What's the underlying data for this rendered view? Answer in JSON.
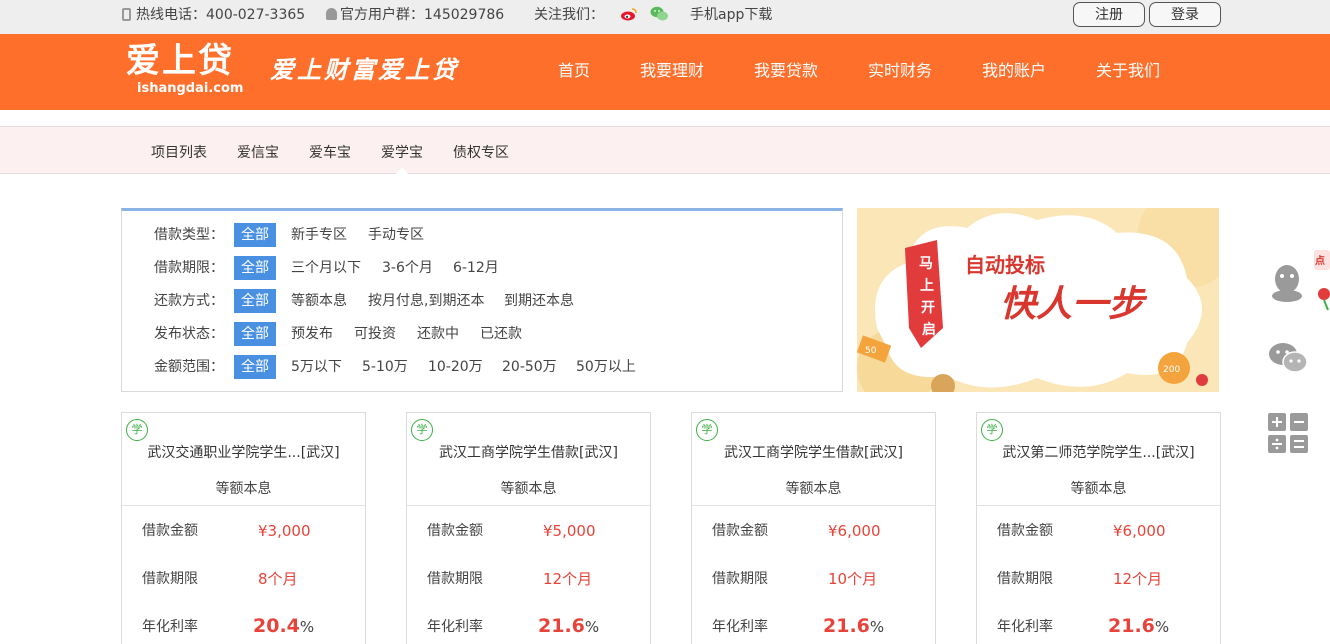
{
  "topbar": {
    "hotline": "热线电话：400-027-3365",
    "group": "官方用户群：145029786",
    "follow_label": "关注我们：",
    "app_download": "手机app下载",
    "register": "注册",
    "login": "登录",
    "social_icons": [
      "weibo-icon",
      "wechat-icon"
    ]
  },
  "header": {
    "logo_text": "爱上贷",
    "logo_domain": "ishangdai.com",
    "slogan": "爱上财富爱上贷",
    "nav": [
      "首页",
      "我要理财",
      "我要贷款",
      "实时财务",
      "我的账户",
      "关于我们"
    ]
  },
  "subnav": {
    "items": [
      "项目列表",
      "爱信宝",
      "爱车宝",
      "爱学宝",
      "债权专区"
    ],
    "active": "爱学宝"
  },
  "filters": [
    {
      "label": "借款类型：",
      "options": [
        "全部",
        "新手专区",
        "手动专区"
      ],
      "selected": "全部"
    },
    {
      "label": "借款期限：",
      "options": [
        "全部",
        "三个月以下",
        "3-6个月",
        "6-12月"
      ],
      "selected": "全部"
    },
    {
      "label": "还款方式：",
      "options": [
        "全部",
        "等额本息",
        "按月付息,到期还本",
        "到期还本息"
      ],
      "selected": "全部"
    },
    {
      "label": "发布状态：",
      "options": [
        "全部",
        "预发布",
        "可投资",
        "还款中",
        "已还款"
      ],
      "selected": "全部"
    },
    {
      "label": "金额范围：",
      "options": [
        "全部",
        "5万以下",
        "5-10万",
        "10-20万",
        "20-50万",
        "50万以上"
      ],
      "selected": "全部"
    }
  ],
  "banner": {
    "ribbon": [
      "马",
      "上",
      "开",
      "启"
    ],
    "line1": "自动投标",
    "line2": "快人一步",
    "coin_left": "50",
    "coin_right": "200"
  },
  "cards": [
    {
      "badge": "学",
      "title": "武汉交通职业学院学生...[武汉]",
      "method": "等额本息",
      "amount_label": "借款金额",
      "amount": "¥3,000",
      "term_label": "借款期限",
      "term": "8个月",
      "rate_label": "年化利率",
      "rate": "20.4",
      "rate_unit": "%"
    },
    {
      "badge": "学",
      "title": "武汉工商学院学生借款[武汉]",
      "method": "等额本息",
      "amount_label": "借款金额",
      "amount": "¥5,000",
      "term_label": "借款期限",
      "term": "12个月",
      "rate_label": "年化利率",
      "rate": "21.6",
      "rate_unit": "%"
    },
    {
      "badge": "学",
      "title": "武汉工商学院学生借款[武汉]",
      "method": "等额本息",
      "amount_label": "借款金额",
      "amount": "¥6,000",
      "term_label": "借款期限",
      "term": "10个月",
      "rate_label": "年化利率",
      "rate": "21.6",
      "rate_unit": "%"
    },
    {
      "badge": "学",
      "title": "武汉第二师范学院学生...[武汉]",
      "method": "等额本息",
      "amount_label": "借款金额",
      "amount": "¥6,000",
      "term_label": "借款期限",
      "term": "12个月",
      "rate_label": "年化利率",
      "rate": "21.6",
      "rate_unit": "%"
    }
  ],
  "side_toolbar": {
    "icons": [
      "qq-icon",
      "wechat-icon",
      "calculator-icon"
    ],
    "promo_text": "点"
  },
  "colors": {
    "brand_orange": "#ff6f2c",
    "accent_blue": "#4a90e2",
    "value_red": "#e8433a",
    "badge_green": "#3cb043"
  }
}
